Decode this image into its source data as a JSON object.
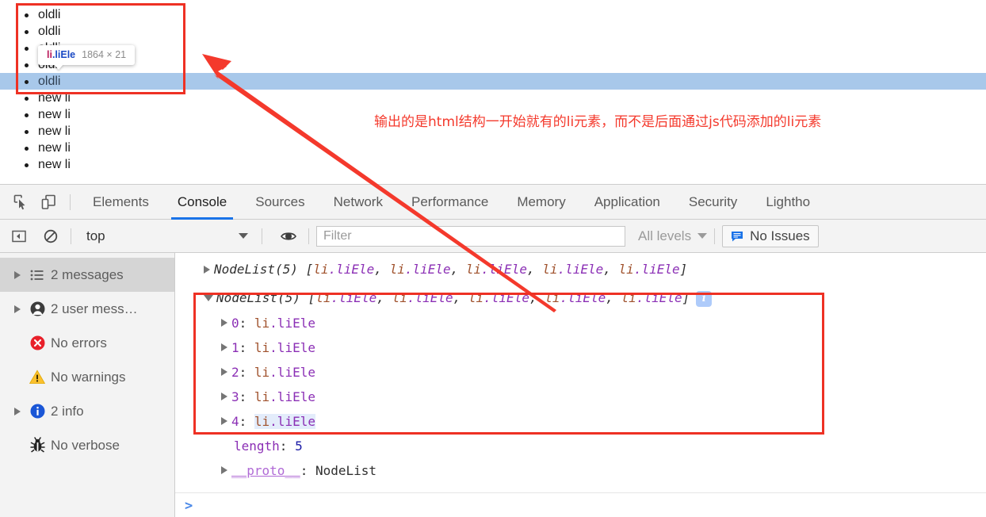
{
  "page": {
    "list_items": [
      {
        "text": "oldli",
        "hovered": false
      },
      {
        "text": "oldli",
        "hovered": false
      },
      {
        "text": "oldli",
        "hovered": false
      },
      {
        "text": "oldli",
        "hovered": false
      },
      {
        "text": "oldli",
        "hovered": true
      },
      {
        "text": "new li",
        "hovered": false
      },
      {
        "text": "new li",
        "hovered": false
      },
      {
        "text": "new li",
        "hovered": false
      },
      {
        "text": "new li",
        "hovered": false
      },
      {
        "text": "new li",
        "hovered": false
      }
    ],
    "tooltip": {
      "tag": "li",
      "class": ".liEle",
      "dimensions": "1864 × 21"
    }
  },
  "annotation": {
    "note_text": "输出的是html结构一开始就有的li元素，而不是后面通过js代码添加的li元素",
    "color": "#f4392c"
  },
  "devtools": {
    "toolbar_icons": [
      {
        "name": "inspect-element-icon"
      },
      {
        "name": "device-toolbar-icon"
      }
    ],
    "tabs": [
      {
        "label": "Elements",
        "active": false
      },
      {
        "label": "Console",
        "active": true
      },
      {
        "label": "Sources",
        "active": false
      },
      {
        "label": "Network",
        "active": false
      },
      {
        "label": "Performance",
        "active": false
      },
      {
        "label": "Memory",
        "active": false
      },
      {
        "label": "Application",
        "active": false
      },
      {
        "label": "Security",
        "active": false
      },
      {
        "label": "Lightho",
        "active": false
      }
    ],
    "active_tab_accent": "#1a73e8",
    "filterbar": {
      "sidebar_toggle_icon": "show-console-sidebar-icon",
      "clear_icon": "clear-console-icon",
      "context": "top",
      "eye_icon": "live-expression-icon",
      "filter_placeholder": "Filter",
      "filter_value": "",
      "levels_label": "All levels",
      "issues_label": "No Issues",
      "issues_icon_color": "#1a73e8"
    },
    "sidebar": [
      {
        "label": "2 messages",
        "icon": "list-icon",
        "expandable": true,
        "selected": true
      },
      {
        "label": "2 user mess…",
        "icon": "user-icon",
        "expandable": true,
        "selected": false
      },
      {
        "label": "No errors",
        "icon": "error-icon",
        "expandable": false,
        "selected": false
      },
      {
        "label": "No warnings",
        "icon": "warning-icon",
        "expandable": false,
        "selected": false
      },
      {
        "label": "2 info",
        "icon": "info-icon",
        "expandable": true,
        "selected": false
      },
      {
        "label": "No verbose",
        "icon": "bug-icon",
        "expandable": false,
        "selected": false
      }
    ],
    "console": {
      "line1": {
        "prefix": "NodeList(5)",
        "open_bracket": " [",
        "close_bracket": "]",
        "tag": "li",
        "class": ".liEle",
        "separator": ", ",
        "count": 5,
        "expanded": false
      },
      "line2": {
        "prefix": "NodeList(5)",
        "open_bracket": " [",
        "close_bracket": "]",
        "tag": "li",
        "class": ".liEle",
        "separator": ", ",
        "count": 5,
        "expanded": true,
        "info_badge": "i"
      },
      "children": [
        {
          "index": "0",
          "tag": "li",
          "class": ".liEle",
          "highlighted": false
        },
        {
          "index": "1",
          "tag": "li",
          "class": ".liEle",
          "highlighted": false
        },
        {
          "index": "2",
          "tag": "li",
          "class": ".liEle",
          "highlighted": false
        },
        {
          "index": "3",
          "tag": "li",
          "class": ".liEle",
          "highlighted": false
        },
        {
          "index": "4",
          "tag": "li",
          "class": ".liEle",
          "highlighted": true
        }
      ],
      "length_key": "length",
      "length_value": "5",
      "proto_key": "__proto__",
      "proto_value": "NodeList",
      "prompt": ">"
    }
  }
}
